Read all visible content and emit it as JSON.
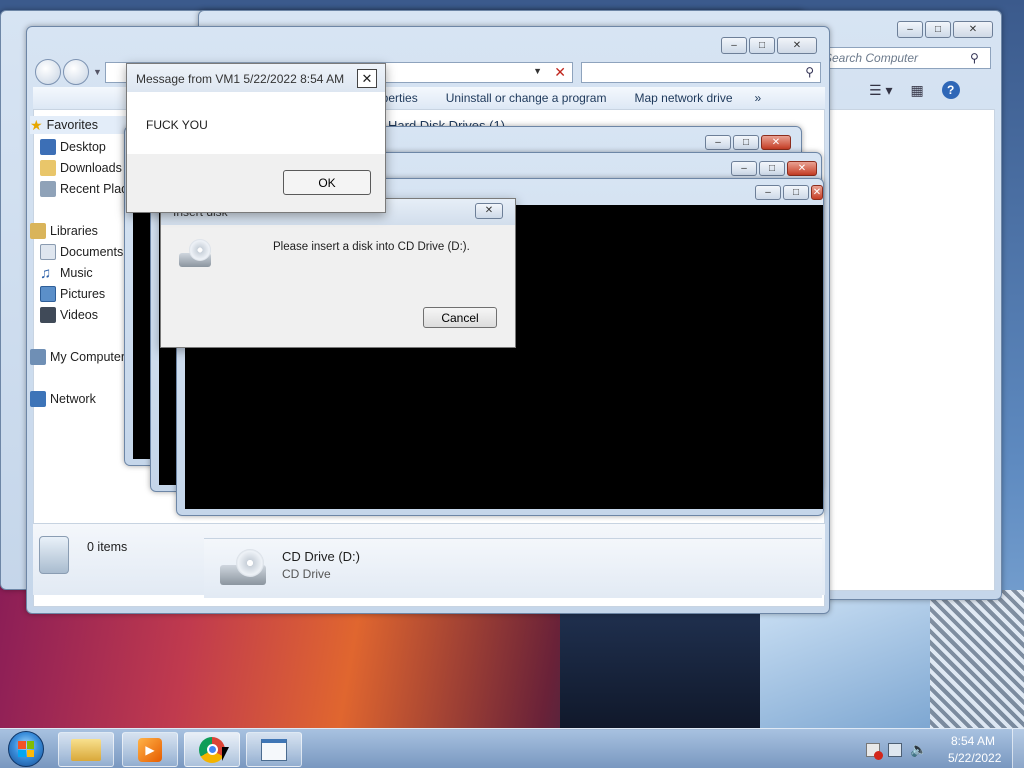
{
  "explorer_back": {
    "search_placeholder": "Search Computer",
    "status_items": "0 items"
  },
  "explorer_main": {
    "toolbar": {
      "properties": "Properties",
      "uninstall": "Uninstall or change a program",
      "map_drive": "Map network drive",
      "more": "»"
    },
    "group_header": "Hard Disk Drives (1)",
    "sidebar": {
      "favorites": "Favorites",
      "desktop": "Desktop",
      "downloads": "Downloads",
      "recent": "Recent Places",
      "libraries": "Libraries",
      "documents": "Documents",
      "music": "Music",
      "pictures": "Pictures",
      "videos": "Videos",
      "computer": "My Computer",
      "network": "Network"
    },
    "details": {
      "drive_name": "CD Drive (D:)",
      "drive_type": "CD Drive"
    }
  },
  "message_dialog": {
    "title": "Message from VM1 5/22/2022 8:54 AM",
    "body": "FUCK YOU",
    "ok": "OK"
  },
  "insert_dialog": {
    "title": "Insert disk",
    "body": "Please insert a disk into CD Drive (D:).",
    "cancel": "Cancel"
  },
  "taskbar": {
    "time": "8:54 AM",
    "date": "5/22/2022"
  },
  "icons": [
    "windows-start-orb",
    "folder-icon",
    "media-player-icon",
    "chrome-icon",
    "notepad-icon",
    "flag-icon",
    "network-icon",
    "volume-icon",
    "cd-drive-icon",
    "recycle-bin-icon"
  ]
}
